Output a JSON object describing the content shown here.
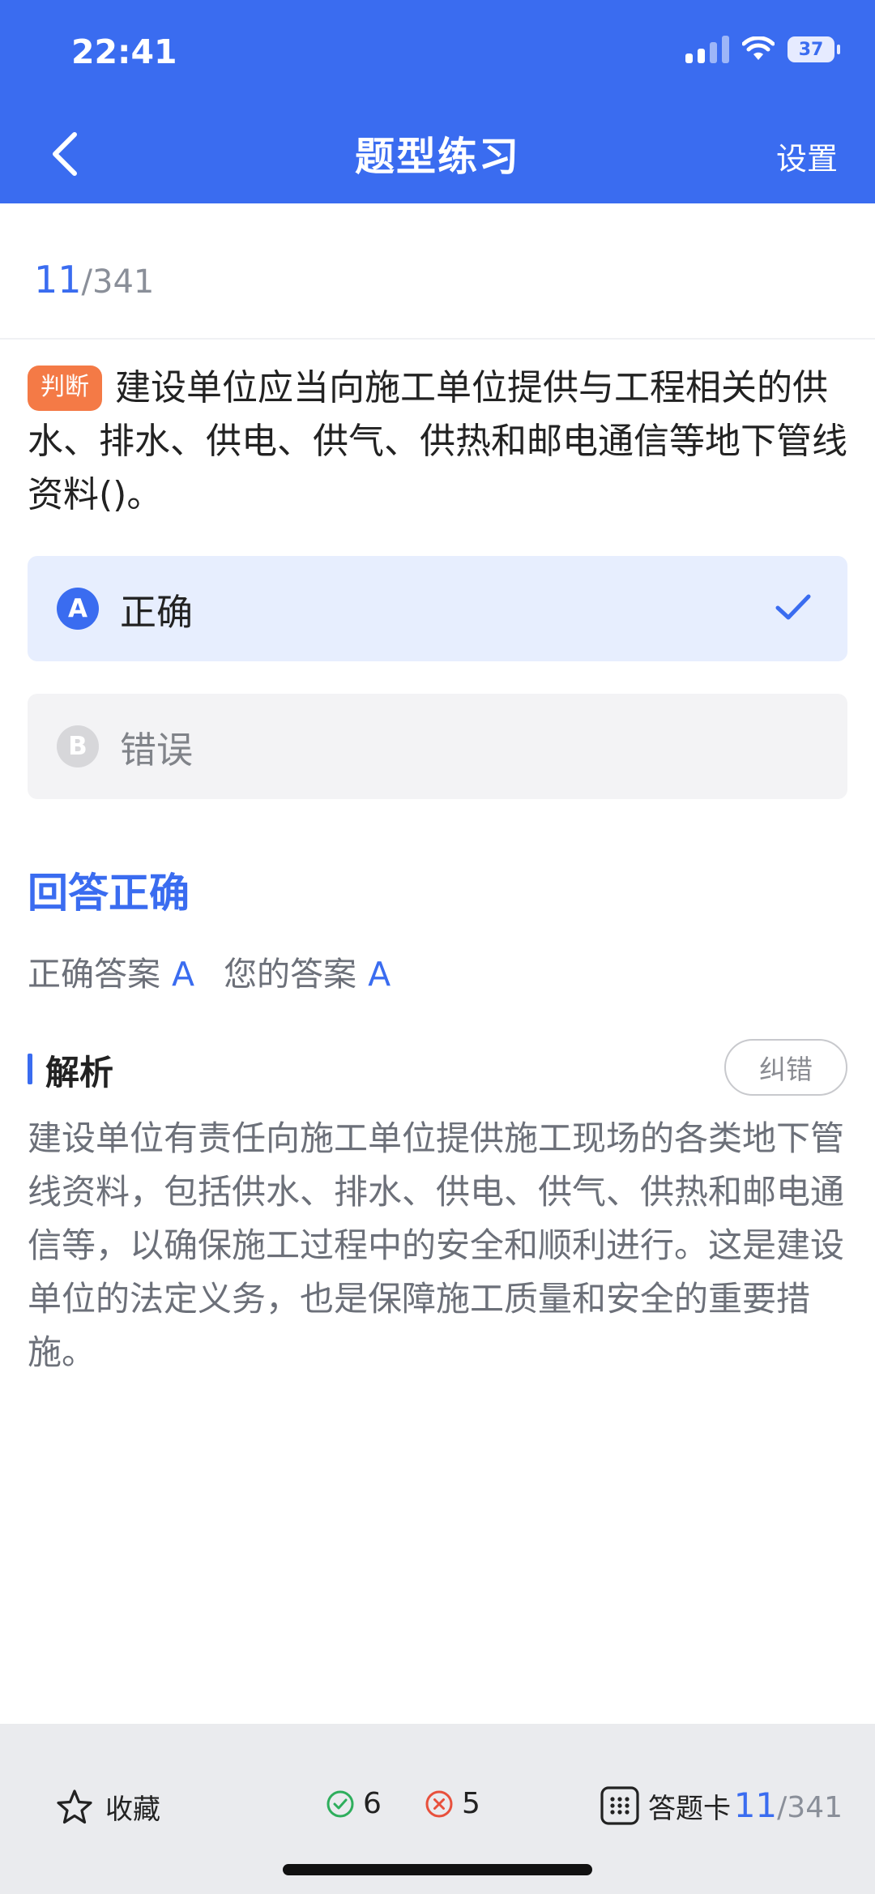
{
  "status": {
    "time": "22:41",
    "battery": "37"
  },
  "nav": {
    "title": "题型练习",
    "settings": "设置"
  },
  "progress": {
    "current": "11",
    "total": "/341"
  },
  "question": {
    "type": "判断",
    "text": "建设单位应当向施工单位提供与工程相关的供水、排水、供电、供气、供热和邮电通信等地下管线资料()。"
  },
  "options": [
    {
      "letter": "A",
      "text": "正确",
      "state": "selected-correct"
    },
    {
      "letter": "B",
      "text": "错误",
      "state": "unselected"
    }
  ],
  "result": {
    "status": "回答正确",
    "correct_label": "正确答案",
    "correct_value": "A",
    "yours_label": "您的答案",
    "yours_value": "A"
  },
  "analysis": {
    "title": "解析",
    "report_button": "纠错",
    "text": "建设单位有责任向施工单位提供施工现场的各类地下管线资料，包括供水、排水、供电、供气、供热和邮电通信等，以确保施工过程中的安全和顺利进行。这是建设单位的法定义务，也是保障施工质量和安全的重要措施。"
  },
  "footer": {
    "favorite": "收藏",
    "correct_count": "6",
    "wrong_count": "5",
    "answer_card": "答题卡",
    "current": "11",
    "total": "/341"
  },
  "colors": {
    "accent": "#3a6cf0",
    "tag": "#f47a46",
    "correct": "#2eae5c",
    "wrong": "#e8503c"
  },
  "icons": [
    "back-chevron-icon",
    "check-icon",
    "star-icon",
    "check-circle-icon",
    "cross-circle-icon",
    "grid-icon"
  ]
}
